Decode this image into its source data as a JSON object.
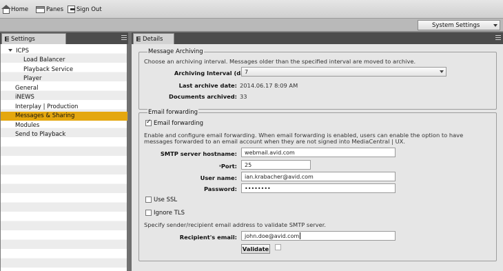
{
  "toolbar": {
    "home": "Home",
    "panes": "Panes",
    "sign_out": "Sign Out"
  },
  "system_select": {
    "value": "System Settings"
  },
  "settings_panel": {
    "tab": "Settings",
    "items": [
      {
        "label": "ICPS"
      },
      {
        "label": "Load Balancer"
      },
      {
        "label": "Playback Service"
      },
      {
        "label": "Player"
      },
      {
        "label": "General"
      },
      {
        "label": "iNEWS"
      },
      {
        "label": "Interplay | Production"
      },
      {
        "label": "Messages & Sharing"
      },
      {
        "label": "Modules"
      },
      {
        "label": "Send to Playback"
      }
    ]
  },
  "details_panel": {
    "tab": "Details",
    "archiving": {
      "legend": "Message Archiving",
      "description": "Choose an archiving interval. Messages older than the specified interval are moved to archive.",
      "interval_label": "Archiving Interval (days):",
      "interval_value": "7",
      "last_date_label": "Last archive date:",
      "last_date_value": "2014.06.17 8:09 AM",
      "archived_label": "Documents archived:",
      "archived_value": "33"
    },
    "email": {
      "legend": "Email forwarding",
      "checkbox_label": "Email forwarding",
      "description_line1": "Enable and configure email forwarding. When email forwarding is enabled, users can enable the option to have",
      "description_line2": "messages forwarded to an email account when they are not signed into MediaCentral | UX.",
      "smtp_label": "SMTP server hostname:",
      "smtp_value": "webmail.avid.com",
      "port_label": "Port:",
      "port_value": "25",
      "user_label": "User name:",
      "user_value": "ian.krabacher@avid.com",
      "password_label": "Password:",
      "password_value": "••••••••",
      "ssl_label": "Use SSL",
      "tls_label": "Ignore TLS",
      "validate_desc": "Specify sender/recipient email address to validate SMTP server.",
      "recipient_label": "Recipient's email:",
      "recipient_value": "john.doe@avid.com",
      "validate_button": "Validate"
    }
  }
}
